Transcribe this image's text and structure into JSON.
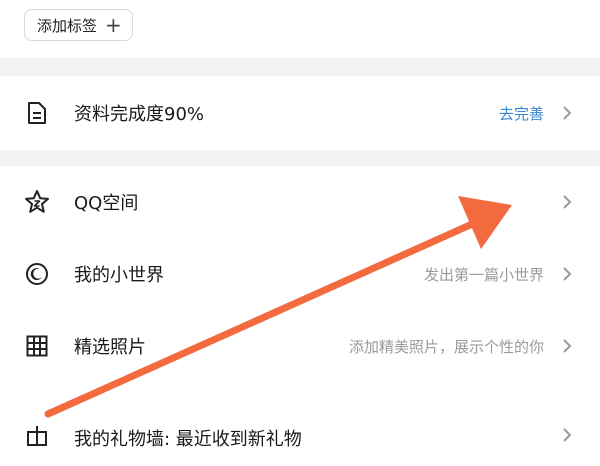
{
  "tags": {
    "add_label": "添加标签",
    "add_symbol": "+"
  },
  "profile": {
    "title": "资料完成度90%",
    "action": "去完善"
  },
  "items": [
    {
      "title": "QQ空间",
      "right": ""
    },
    {
      "title": "我的小世界",
      "right": "发出第一篇小世界"
    },
    {
      "title": "精选照片",
      "right": "添加精美照片，展示个性的你"
    },
    {
      "title": "我的礼物墙: 最近收到新礼物",
      "right": ""
    }
  ],
  "colors": {
    "accent_blue": "#3a86d6",
    "annotation_arrow": "#f26a3d"
  },
  "icons": [
    "document-icon",
    "star-icon",
    "moon-circle-icon",
    "grid-icon",
    "gift-icon",
    "chevron-right-icon",
    "plus-icon"
  ]
}
